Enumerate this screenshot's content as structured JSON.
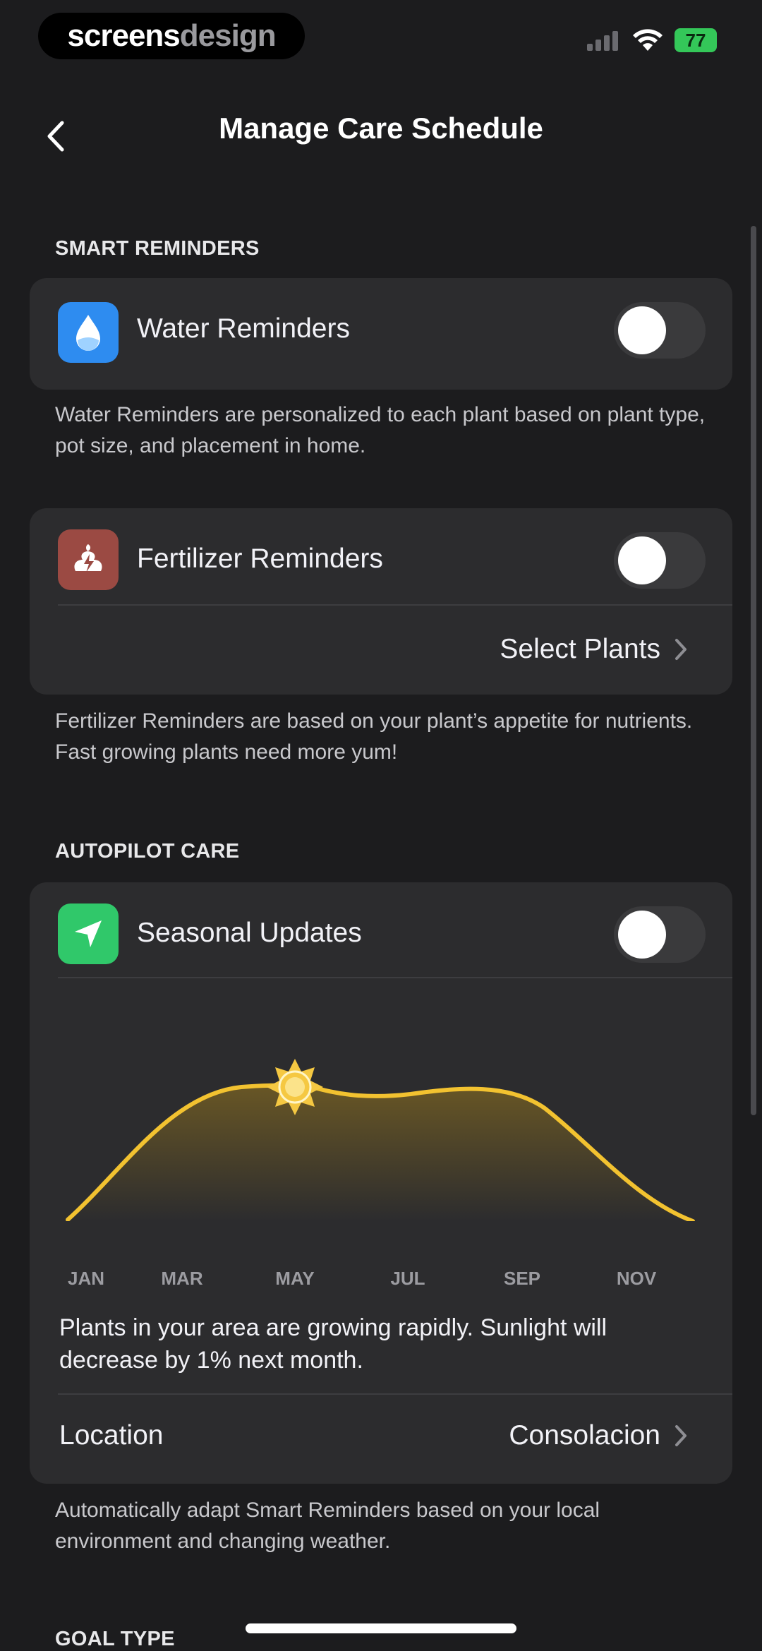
{
  "status_bar": {
    "brand_part1": "screens",
    "brand_part2": "design",
    "battery": "77"
  },
  "nav": {
    "title": "Manage Care Schedule"
  },
  "smart_reminders": {
    "header": "SMART REMINDERS",
    "water": {
      "label": "Water Reminders",
      "enabled": false,
      "footnote": "Water Reminders are personalized to each plant based on plant type, pot size, and placement in home.",
      "icon": "water-drop-icon",
      "icon_color": "#2e8cf0"
    },
    "fertilizer": {
      "label": "Fertilizer Reminders",
      "enabled": false,
      "select_plants": "Select Plants",
      "footnote": "Fertilizer Reminders are based on your plant’s appetite for nutrients. Fast growing plants need more yum!",
      "icon": "fertilizer-icon",
      "icon_color": "#9b4a43"
    }
  },
  "autopilot": {
    "header": "AUTOPILOT CARE",
    "seasonal": {
      "label": "Seasonal Updates",
      "enabled": false,
      "icon": "navigation-arrow-icon",
      "icon_color": "#30c86a"
    },
    "chart_months": [
      "JAN",
      "MAR",
      "MAY",
      "JUL",
      "SEP",
      "NOV"
    ],
    "growth_text": "Plants in your area are growing rapidly. Sunlight will decrease by 1% next month.",
    "location_label": "Location",
    "location_value": "Consolacion",
    "footnote": "Automatically adapt Smart Reminders based on your local environment and changing weather."
  },
  "goal_type": {
    "header": "GOAL TYPE"
  },
  "colors": {
    "background": "#1c1c1e",
    "card": "#2c2c2e",
    "curve": "#f2c230"
  }
}
